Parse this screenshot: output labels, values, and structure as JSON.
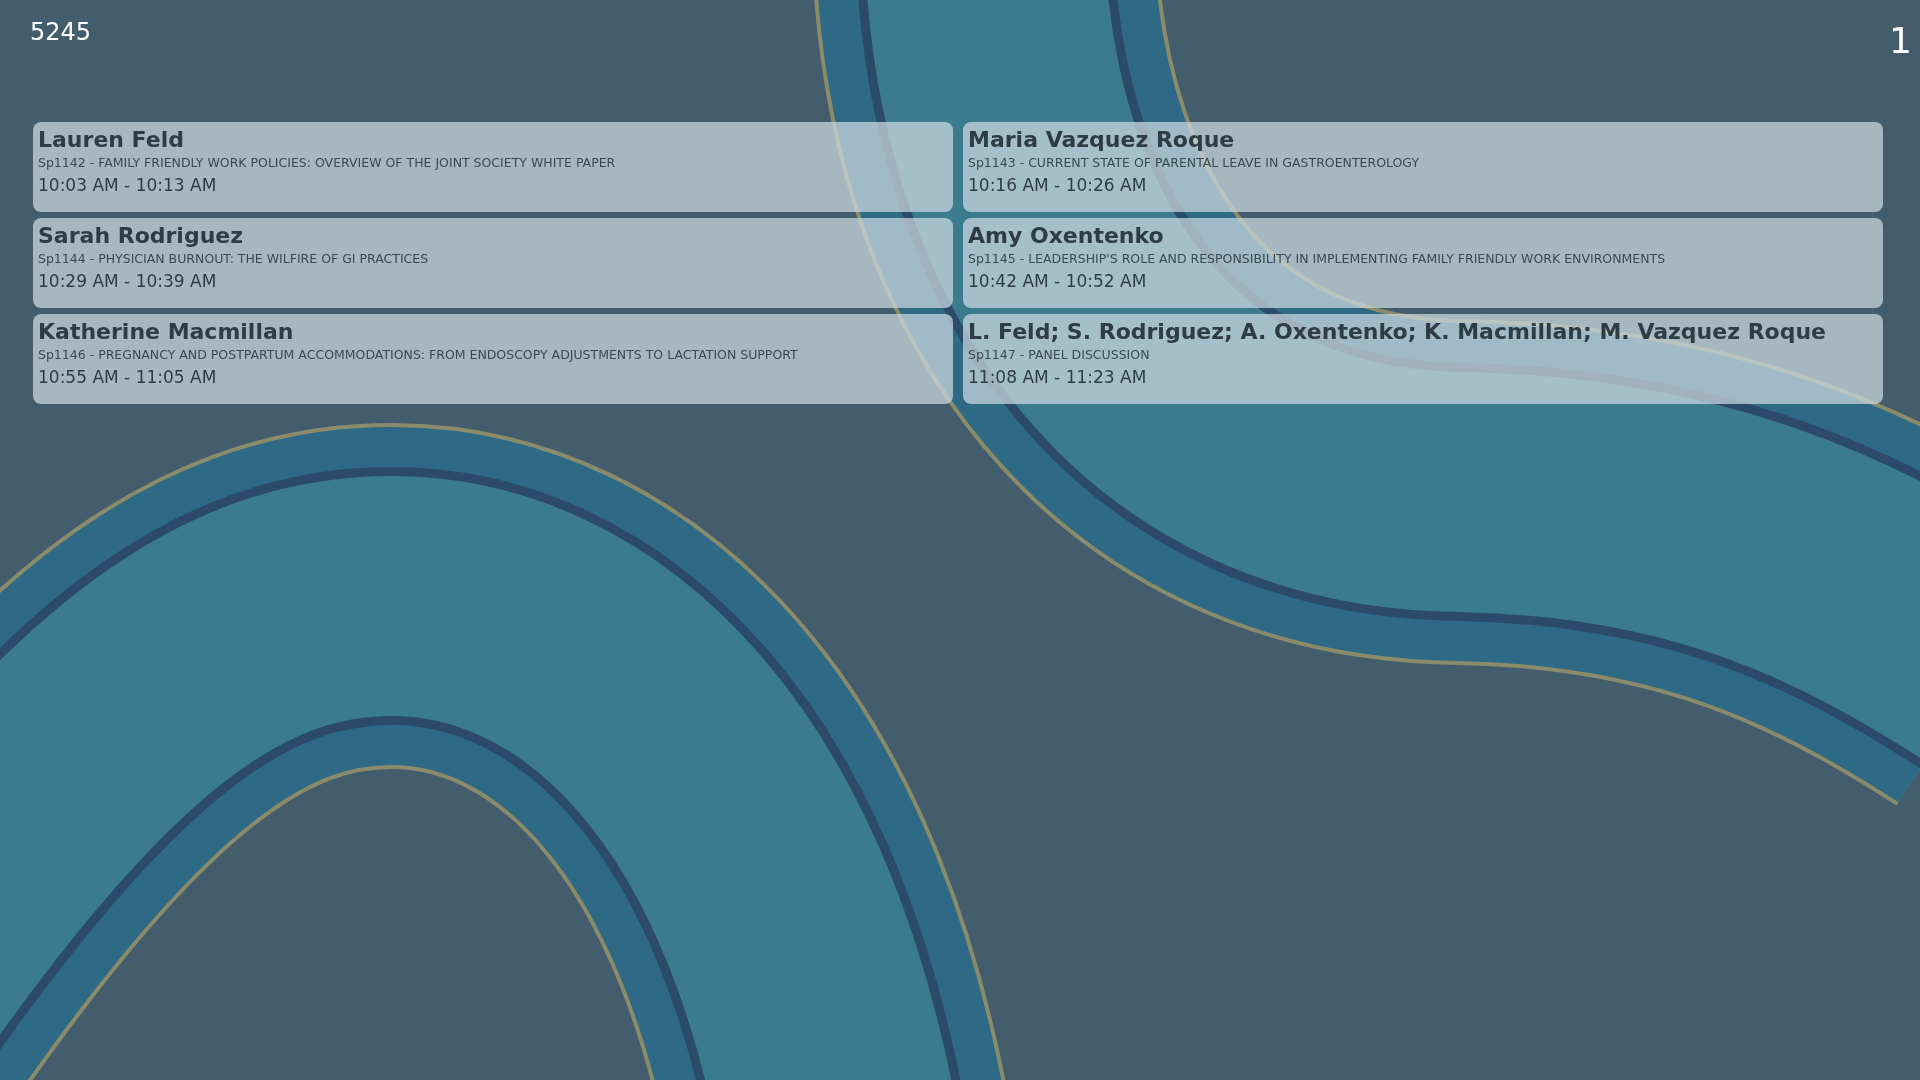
{
  "room": "5245",
  "page_number": "1",
  "sessions": [
    {
      "speaker": "Lauren Feld",
      "title": "Sp1142 - FAMILY FRIENDLY WORK POLICIES: OVERVIEW OF THE JOINT SOCIETY WHITE PAPER",
      "time": "10:03 AM - 10:13 AM"
    },
    {
      "speaker": "Maria Vazquez Roque",
      "title": "Sp1143 - CURRENT STATE OF PARENTAL LEAVE IN GASTROENTEROLOGY",
      "time": "10:16 AM - 10:26 AM"
    },
    {
      "speaker": "Sarah Rodriguez",
      "title": "Sp1144 - PHYSICIAN BURNOUT: THE WILFIRE OF GI PRACTICES",
      "time": "10:29 AM - 10:39 AM"
    },
    {
      "speaker": "Amy Oxentenko",
      "title": "Sp1145 - LEADERSHIP'S ROLE AND RESPONSIBILITY IN IMPLEMENTING FAMILY FRIENDLY WORK ENVIRONMENTS",
      "time": "10:42 AM - 10:52 AM"
    },
    {
      "speaker": "Katherine Macmillan",
      "title": "Sp1146 - PREGNANCY AND POSTPARTUM ACCOMMODATIONS: FROM ENDOSCOPY ADJUSTMENTS TO LACTATION SUPPORT",
      "time": "10:55 AM - 11:05 AM"
    },
    {
      "speaker": "L. Feld; S. Rodriguez; A. Oxentenko; K. Macmillan; M. Vazquez Roque",
      "title": "Sp1147 - PANEL DISCUSSION",
      "time": "11:08 AM - 11:23 AM"
    }
  ]
}
